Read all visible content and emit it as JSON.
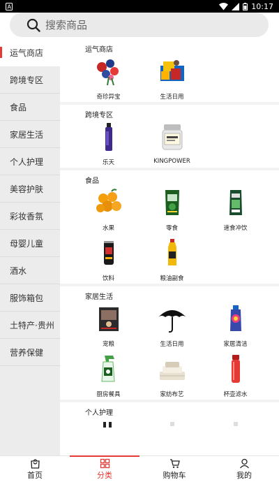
{
  "status_bar": {
    "time": "10:17"
  },
  "search": {
    "placeholder": "搜索商品"
  },
  "sidebar": {
    "items": [
      {
        "label": "运气商店",
        "active": true
      },
      {
        "label": "跨境专区"
      },
      {
        "label": "食品"
      },
      {
        "label": "家居生活"
      },
      {
        "label": "个人护理"
      },
      {
        "label": "美容护肤"
      },
      {
        "label": "彩妆香氛"
      },
      {
        "label": "母婴儿童"
      },
      {
        "label": "酒水"
      },
      {
        "label": "服饰箱包"
      },
      {
        "label": "土特产·贵州"
      },
      {
        "label": "营养保健"
      }
    ]
  },
  "sections": [
    {
      "title": "运气商店",
      "items": [
        {
          "label": "奇珍异宝",
          "icon": "flowers-icon"
        },
        {
          "label": "生活日用",
          "icon": "gift-box-icon"
        }
      ]
    },
    {
      "title": "跨境专区",
      "items": [
        {
          "label": "乐天",
          "icon": "bottle-icon"
        },
        {
          "label": "KINGPOWER",
          "icon": "jar-icon"
        }
      ]
    },
    {
      "title": "食品",
      "items": [
        {
          "label": "水果",
          "icon": "fruit-icon"
        },
        {
          "label": "零食",
          "icon": "snack-bag-icon"
        },
        {
          "label": "速食冲饮",
          "icon": "drink-pack-icon"
        },
        {
          "label": "饮料",
          "icon": "can-icon"
        },
        {
          "label": "粮油副食",
          "icon": "oil-bottle-icon"
        }
      ]
    },
    {
      "title": "家居生活",
      "items": [
        {
          "label": "宠粮",
          "icon": "pet-food-icon"
        },
        {
          "label": "生活日用",
          "icon": "umbrella-icon"
        },
        {
          "label": "家居清洁",
          "icon": "cleaner-icon"
        },
        {
          "label": "厨房餐具",
          "icon": "spray-icon"
        },
        {
          "label": "家纺布艺",
          "icon": "towel-icon"
        },
        {
          "label": "杯壶滤水",
          "icon": "thermos-icon"
        }
      ]
    },
    {
      "title": "个人护理",
      "items": []
    }
  ],
  "tabbar": {
    "items": [
      {
        "label": "首页",
        "icon": "home-bag-icon"
      },
      {
        "label": "分类",
        "icon": "category-grid-icon",
        "active": true
      },
      {
        "label": "购物车",
        "icon": "cart-icon"
      },
      {
        "label": "我的",
        "icon": "user-icon"
      }
    ]
  },
  "colors": {
    "accent": "#e53935",
    "sidebar_bg": "#ececec",
    "search_bg": "#eaeaea"
  }
}
